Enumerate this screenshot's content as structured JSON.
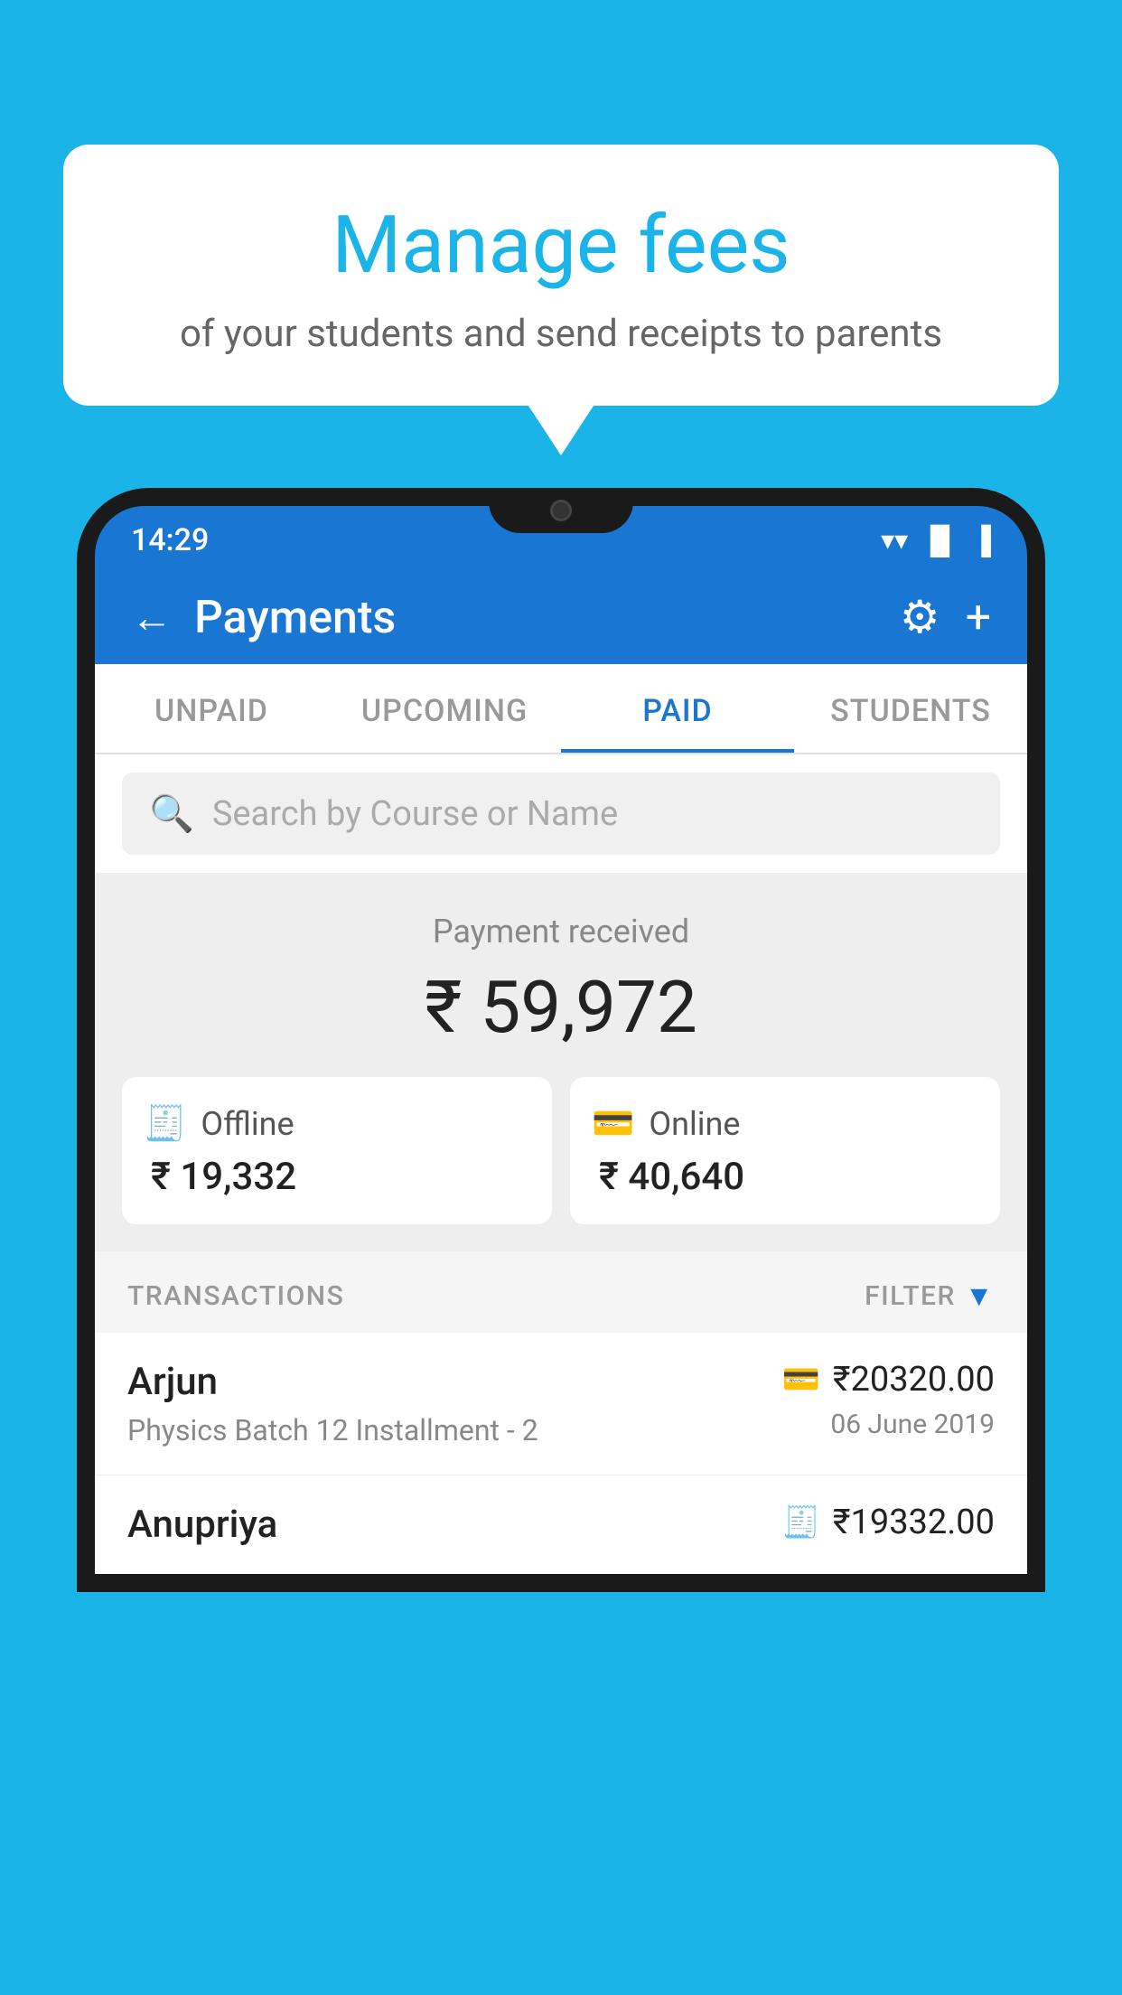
{
  "background_color": "#1ab4e8",
  "speech_bubble": {
    "title": "Manage fees",
    "subtitle": "of your students and send receipts to parents"
  },
  "status_bar": {
    "time": "14:29",
    "wifi": "▲",
    "signal": "▲",
    "battery": "▐"
  },
  "app_bar": {
    "title": "Payments",
    "back_label": "←",
    "gear_label": "⚙",
    "plus_label": "+"
  },
  "tabs": [
    {
      "id": "unpaid",
      "label": "UNPAID",
      "active": false
    },
    {
      "id": "upcoming",
      "label": "UPCOMING",
      "active": false
    },
    {
      "id": "paid",
      "label": "PAID",
      "active": true
    },
    {
      "id": "students",
      "label": "STUDENTS",
      "active": false
    }
  ],
  "search": {
    "placeholder": "Search by Course or Name"
  },
  "payment_summary": {
    "label": "Payment received",
    "amount": "₹ 59,972",
    "offline_label": "Offline",
    "offline_amount": "₹ 19,332",
    "online_label": "Online",
    "online_amount": "₹ 40,640"
  },
  "transactions": {
    "label": "TRANSACTIONS",
    "filter_label": "FILTER"
  },
  "transaction_list": [
    {
      "name": "Arjun",
      "detail": "Physics Batch 12 Installment - 2",
      "amount": "₹20320.00",
      "date": "06 June 2019",
      "payment_type": "online"
    },
    {
      "name": "Anupriya",
      "detail": "",
      "amount": "₹19332.00",
      "date": "",
      "payment_type": "offline"
    }
  ]
}
